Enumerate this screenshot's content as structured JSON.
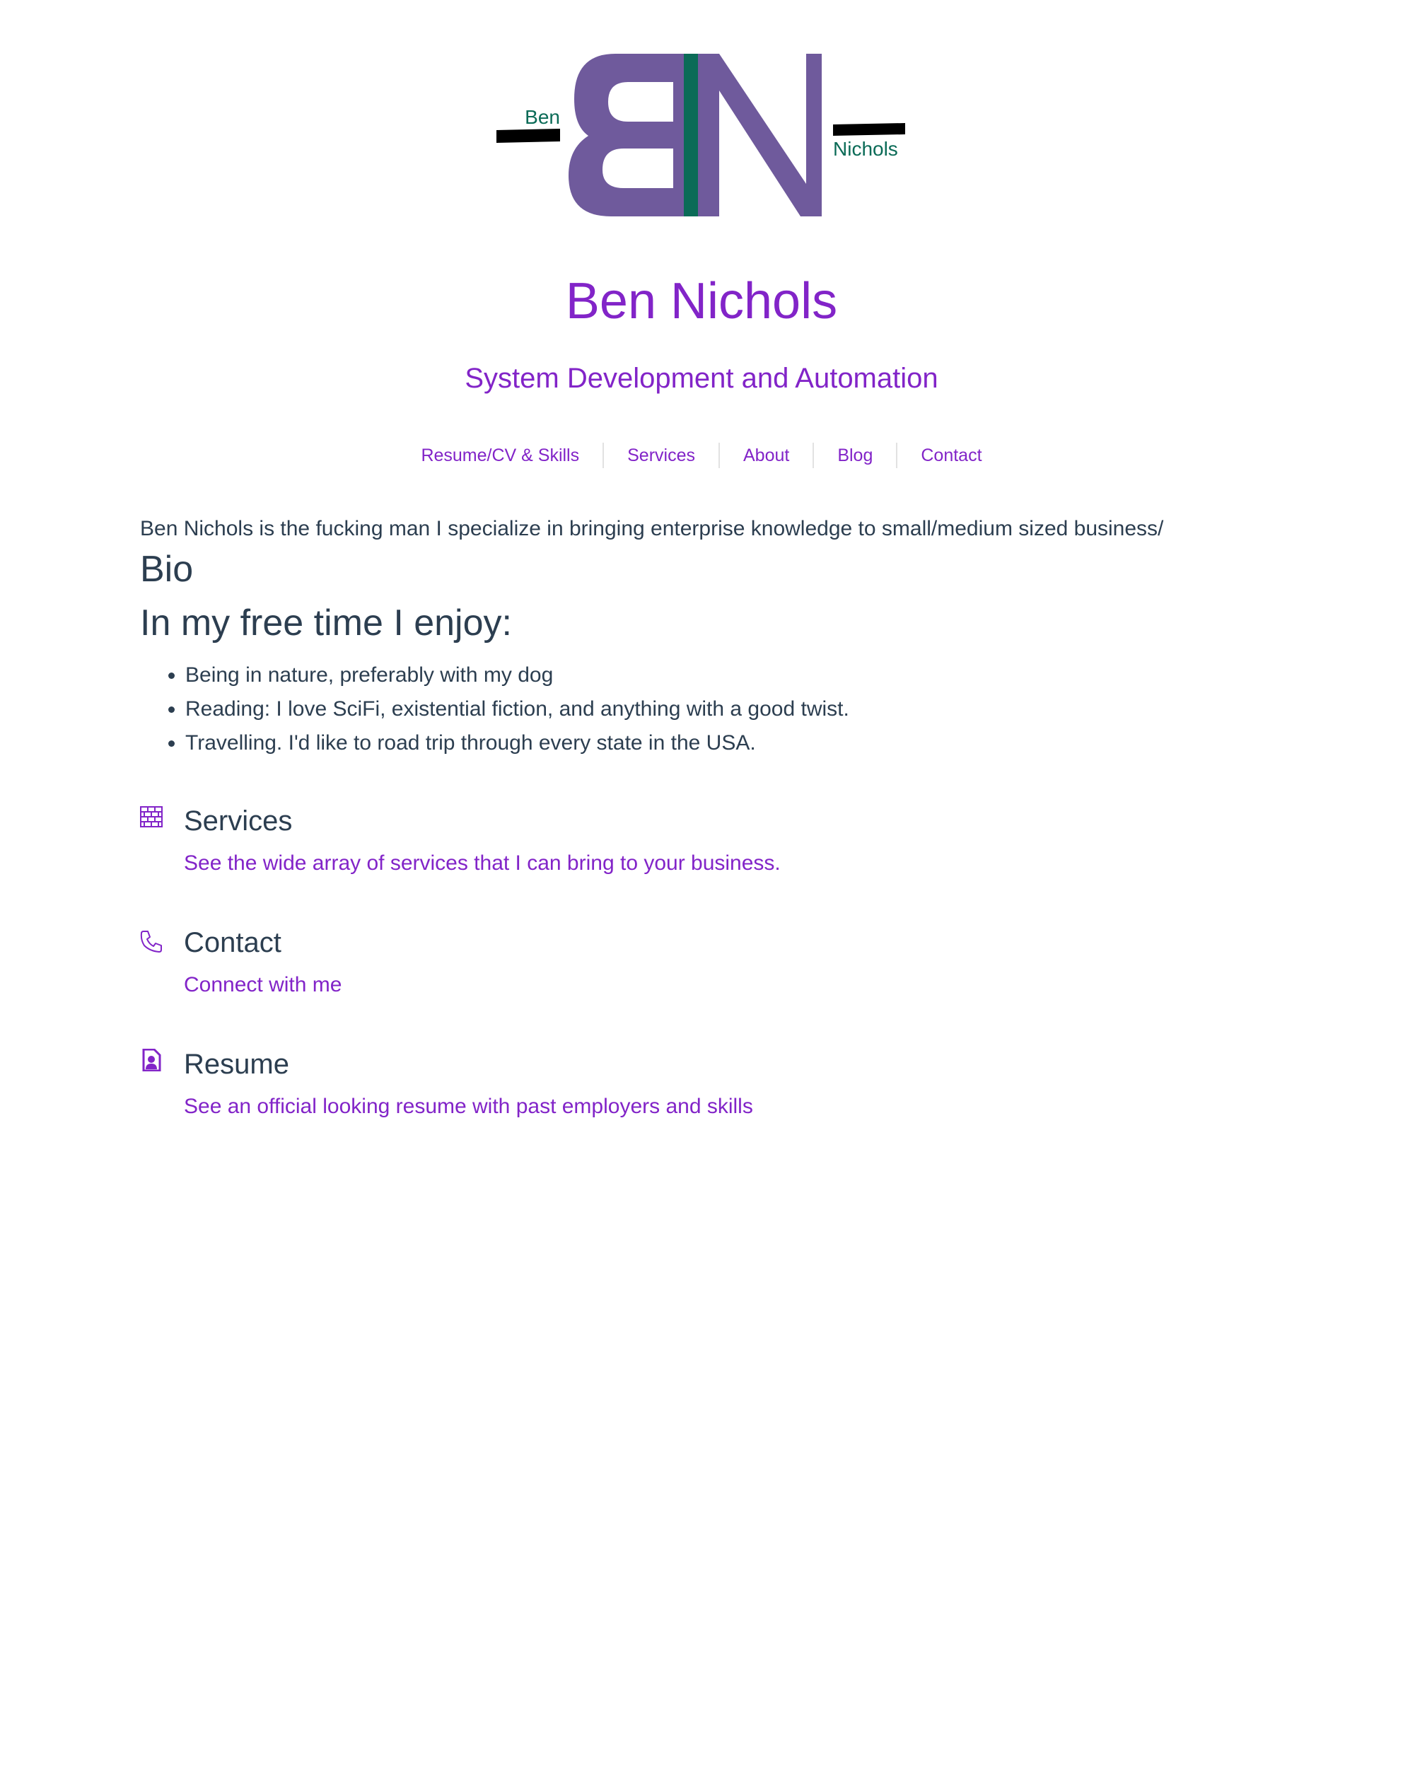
{
  "logo": {
    "monogram": "BN",
    "first_name": "Ben",
    "last_name": "Nichols",
    "colors": {
      "letters": "#6f5a9c",
      "stripe": "#0b6b57",
      "names": "#0b6b57",
      "bars": "#000000"
    }
  },
  "header": {
    "title": "Ben Nichols",
    "subtitle": "System Development and Automation"
  },
  "nav": {
    "items": [
      {
        "label": "Resume/CV & Skills"
      },
      {
        "label": "Services"
      },
      {
        "label": "About"
      },
      {
        "label": "Blog"
      },
      {
        "label": "Contact"
      }
    ]
  },
  "main": {
    "intro": "Ben Nichols is the fucking man I specialize in bringing enterprise knowledge to small/medium sized business/",
    "bio_heading": "Bio",
    "free_time_heading": "In my free time I enjoy:",
    "hobbies": [
      "Being in nature, preferably with my dog",
      "Reading: I love SciFi, existential fiction, and anything with a good twist.",
      "Travelling. I'd like to road trip through every state in the USA."
    ]
  },
  "cards": [
    {
      "icon": "brick-wall-icon",
      "title": "Services",
      "link": "See the wide array of services that I can bring to your business."
    },
    {
      "icon": "phone-icon",
      "title": "Contact",
      "link": "Connect with me"
    },
    {
      "icon": "resume-file-icon",
      "title": "Resume",
      "link": "See an official looking resume with past employers and skills"
    }
  ],
  "colors": {
    "accent": "#8224c8",
    "text": "#2c3e50",
    "separator": "#e2e2e2",
    "background": "#ffffff"
  }
}
